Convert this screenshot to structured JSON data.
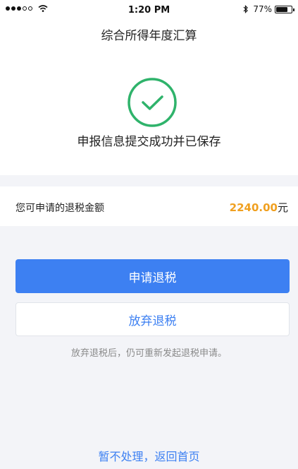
{
  "status_bar": {
    "time": "1:20 PM",
    "battery_text": "77%",
    "battery_level": 0.77,
    "icons": [
      "signal-dots",
      "wifi-icon",
      "bluetooth-icon",
      "battery-icon"
    ]
  },
  "header": {
    "title": "综合所得年度汇算"
  },
  "result": {
    "icon": "check-circle-icon",
    "message": "申报信息提交成功并已保存",
    "accent_color": "#2fb36b"
  },
  "refund": {
    "label": "您可申请的退税金额",
    "amount": "2240.00",
    "unit": "元",
    "amount_color": "#f0a020"
  },
  "actions": {
    "apply_label": "申请退税",
    "abandon_label": "放弃退税",
    "hint": "放弃退税后，仍可重新发起退税申请。",
    "home_link": "暂不处理，返回首页",
    "primary_color": "#3d80f2"
  }
}
